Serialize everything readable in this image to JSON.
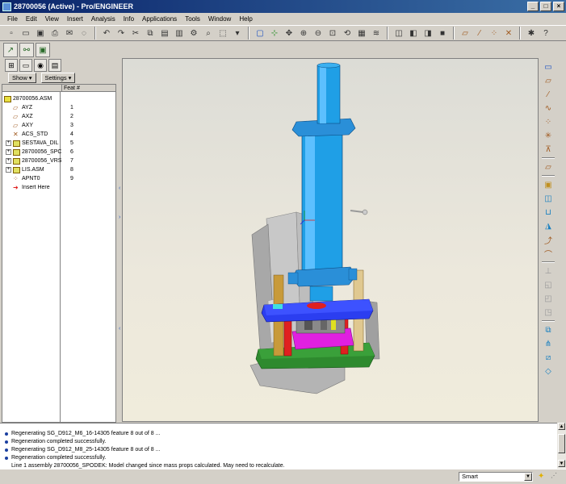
{
  "window": {
    "title": "28700056 (Active) - Pro/ENGINEER",
    "min": "_",
    "max": "□",
    "close": "×"
  },
  "menu": [
    "File",
    "Edit",
    "View",
    "Insert",
    "Analysis",
    "Info",
    "Applications",
    "Tools",
    "Window",
    "Help"
  ],
  "toolbar_icons": [
    "new-icon",
    "open-icon",
    "save-icon",
    "print-icon",
    "email-icon",
    "erase-icon",
    "undo-icon",
    "redo-icon",
    "cut-icon",
    "copy-icon",
    "paste-icon",
    "paste-special-icon",
    "regenerate-icon",
    "search-icon",
    "selection-box-icon",
    "repaint-icon",
    "spin-center-icon",
    "orient-icon",
    "zoom-in-icon",
    "zoom-out-icon",
    "refit-icon",
    "reorient-icon",
    "saved-views-icon",
    "layers-icon",
    "wireframe-icon",
    "hidden-line-icon",
    "no-hidden-icon",
    "shading-icon",
    "datum-planes-icon",
    "datum-axes-icon",
    "datum-points-icon",
    "csys-icon",
    "annotations-icon",
    "help-icon"
  ],
  "left_panel": {
    "show_label": "Show",
    "settings_label": "Settings",
    "col_header": "Feat #",
    "tree": [
      {
        "label": "28700056.ASM",
        "num": "",
        "type": "asm",
        "expand": false
      },
      {
        "label": "AYZ",
        "num": "1",
        "type": "plane",
        "expand": false
      },
      {
        "label": "AXZ",
        "num": "2",
        "type": "plane",
        "expand": false
      },
      {
        "label": "AXY",
        "num": "3",
        "type": "plane",
        "expand": false
      },
      {
        "label": "ACS_STD",
        "num": "4",
        "type": "csys",
        "expand": false
      },
      {
        "label": "SESTAVA_DIL",
        "num": "5",
        "type": "part",
        "expand": true
      },
      {
        "label": "28700056_SPC",
        "num": "6",
        "type": "part",
        "expand": true
      },
      {
        "label": "28700056_VRS",
        "num": "7",
        "type": "part",
        "expand": true
      },
      {
        "label": "LIS.ASM",
        "num": "8",
        "type": "part",
        "expand": true
      },
      {
        "label": "APNT0",
        "num": "9",
        "type": "point",
        "expand": false
      },
      {
        "label": "Insert Here",
        "num": "",
        "type": "insert",
        "expand": false
      }
    ]
  },
  "messages": [
    "Regenerating SG_D912_M6_16-14305 feature 8 out of 8 ...",
    "Regeneration completed successfully.",
    "Regenerating SG_D912_M8_25-14305 feature 8 out of 8 ...",
    "Regeneration completed successfully.",
    "Line 1 assembly 28700056_SPODEK: Model changed since mass props calculated. May need to recalculate."
  ],
  "status": {
    "filter": "Smart"
  },
  "colors": {
    "cylinder": "#1f9fe6",
    "plate_blue": "#2b3ef0",
    "plate_green": "#2e8a2e",
    "magenta": "#e020e0",
    "red": "#e02020",
    "post": "#c89a3a",
    "frame": "#b8b8b8"
  }
}
